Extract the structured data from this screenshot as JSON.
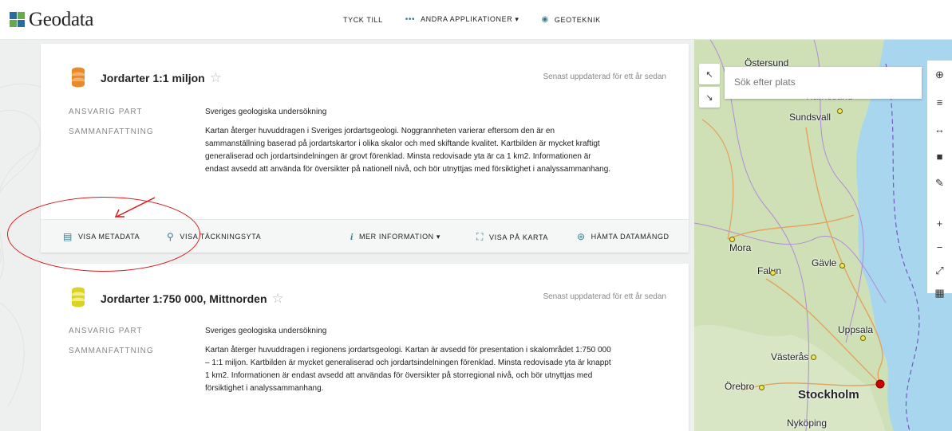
{
  "header": {
    "logo_text": "Geodata",
    "nav": [
      {
        "label": "TYCK TILL",
        "icon": ""
      },
      {
        "label": "ANDRA APPLIKATIONER ▾",
        "icon": "dots-icon"
      },
      {
        "label": "GEOTEKNIK",
        "icon": "eye-icon"
      }
    ]
  },
  "cards": [
    {
      "title": "Jordarter 1:1 miljon",
      "updated": "Senast uppdaterad för ett år sedan",
      "label_owner": "ANSVARIG PART",
      "owner": "Sveriges geologiska undersökning",
      "label_summary": "SAMMANFATTNING",
      "summary": "Kartan återger huvuddragen i Sveriges jordartsgeologi. Noggrannheten varierar eftersom den är en sammanställning baserad på jordartskartor i olika skalor och med skiftande kvalitet. Kartbilden är mycket kraftigt generaliserad och jordartsindelningen är grovt förenklad. Minsta redovisade yta är ca 1 km2. Informationen är endast avsedd att använda för översikter på nationell nivå, och bör utnyttjas med försiktighet i analyssammanhang.",
      "icon_color": "#e8892b"
    },
    {
      "title": "Jordarter 1:750 000, Mittnorden",
      "updated": "Senast uppdaterad för ett år sedan",
      "label_owner": "ANSVARIG PART",
      "owner": "Sveriges geologiska undersökning",
      "label_summary": "SAMMANFATTNING",
      "summary": "Kartan återger huvuddragen i regionens jordartsgeologi. Kartan är avsedd för presentation i skalområdet 1:750 000 – 1:1 miljon. Kartbilden är mycket generaliserad och jordartsindelningen förenklad. Minsta redovisade yta är knappt 1 km2. Informationen är endast avsedd att användas för översikter på storregional nivå, och bör utnyttjas med försiktighet i analyssammanhang.",
      "icon_color": "#e4e23a"
    }
  ],
  "actions": {
    "metadata": "VISA METADATA",
    "coverage": "VISA TÄCKNINGSYTA",
    "more_info": "MER INFORMATION ▾",
    "show_on_map": "VISA PÅ KARTA",
    "download": "HÄMTA DATAMÄNGD"
  },
  "map": {
    "search_placeholder": "Sök efter plats",
    "cities": [
      "Östersund",
      "Härnösand",
      "Sundsvall",
      "Mora",
      "Gävle",
      "Falun",
      "Uppsala",
      "Västerås",
      "Örebro",
      "Stockholm",
      "Nyköping"
    ],
    "tools": [
      "add-layer-icon",
      "layers-icon",
      "measure-icon",
      "draw-area-icon",
      "edit-icon",
      "zoom-in-icon",
      "zoom-out-icon",
      "fullscreen-icon",
      "basemap-icon"
    ],
    "tool_glyphs": [
      "⊕",
      "≡",
      "↔",
      "■",
      "✎",
      "+",
      "−",
      "⤢",
      "▦"
    ]
  }
}
